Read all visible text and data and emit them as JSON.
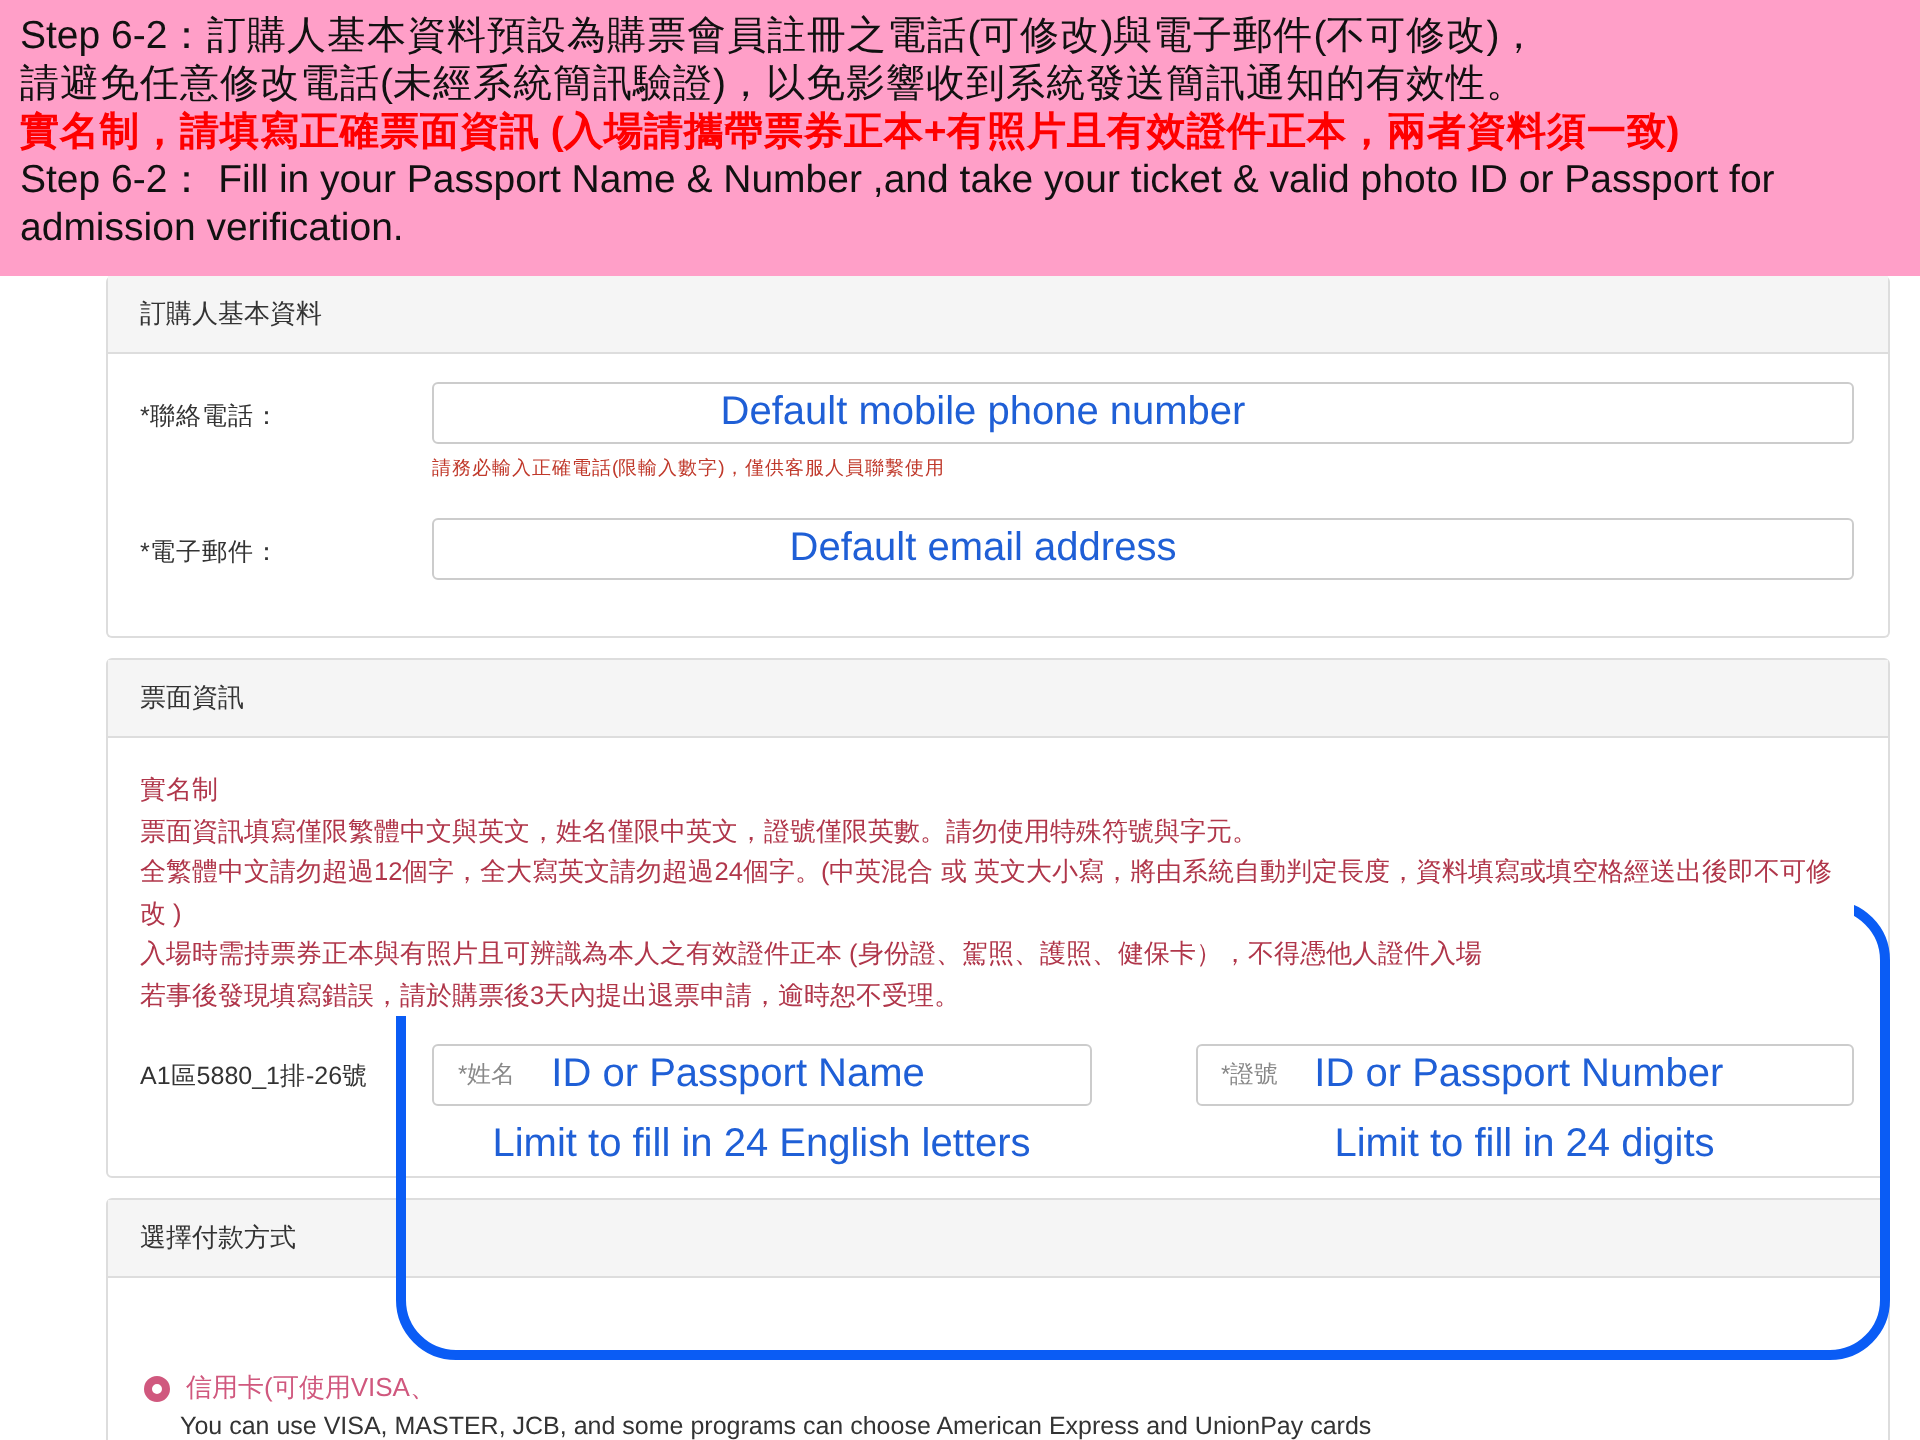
{
  "banner": {
    "lines": [
      {
        "kind": "note",
        "text": "Step 6-2：訂購人基本資料預設為購票會員註冊之電話(可修改)與電子郵件(不可修改)，"
      },
      {
        "kind": "note",
        "text": "請避免任意修改電話(未經系統簡訊驗證)，以免影響收到系統發送簡訊通知的有效性。"
      },
      {
        "kind": "warning",
        "text": "實名制，請填寫正確票面資訊  (入場請攜帶票券正本+有照片且有效證件正本，兩者資料須一致)"
      },
      {
        "kind": "note",
        "text": "Step 6-2：  Fill in your Passport Name & Number ,and take your ticket & valid photo ID or Passport for admission verification."
      }
    ]
  },
  "buyer_panel": {
    "title": "訂購人基本資料",
    "fields": [
      {
        "label": "*聯絡電話：",
        "value": "Default mobile phone number",
        "hint": "請務必輸入正確電話(限輸入數字)，僅供客服人員聯繫使用"
      },
      {
        "label": "*電子郵件：",
        "value": "Default email address"
      }
    ]
  },
  "ticket_panel": {
    "title": "票面資訊",
    "notes": [
      "實名制",
      "票面資訊填寫僅限繁體中文與英文，姓名僅限中英文，證號僅限英數。請勿使用特殊符號與字元。",
      "全繁體中文請勿超過12個字，全大寫英文請勿超過24個字。(中英混合  或  英文大小寫，將由系統自動判定長度，資料填寫或填空格經送出後即不可修改 )",
      "入場時需持票券正本與有照片且可辨識為本人之有效證件正本 (身份證、駕照、護照、健保卡），不得憑他人證件入場",
      "若事後發現填寫錯誤，請於購票後3天內提出退票申請，逾時恕不受理。"
    ],
    "seat": "A1區5880_1排-26號",
    "inputs": [
      {
        "placeholder": "*姓名",
        "value": "ID or Passport Name",
        "note": "Limit to fill in 24 English letters"
      },
      {
        "placeholder": "*證號",
        "value": "ID or Passport Number",
        "note": "Limit to fill in 24 digits"
      }
    ]
  },
  "payment_panel": {
    "title": "選擇付款方式",
    "options": [
      {
        "label": "信用卡(可使用VISA、",
        "description": "You can use VISA, MASTER, JCB, and some programs can choose American Express and UnionPay cards",
        "selected": true
      }
    ]
  }
}
